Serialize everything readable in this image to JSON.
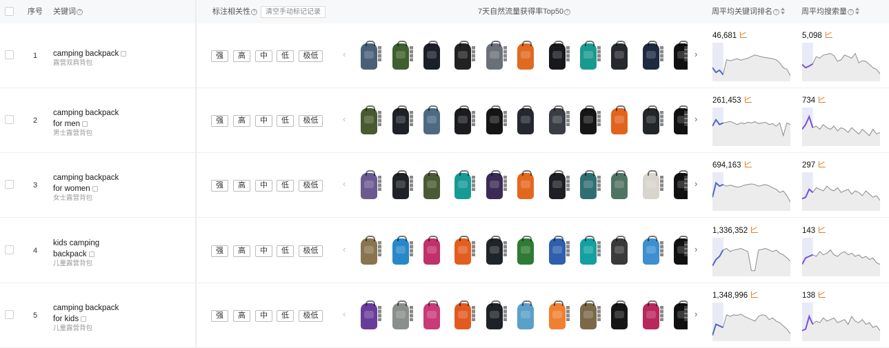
{
  "header": {
    "index_label": "序号",
    "keyword_label": "关键词",
    "relevance_label": "标注相关性",
    "clear_label": "清空手动标记记录",
    "top50_label": "7天自然流量获得率Top50",
    "rank_label": "周平均关键词排名",
    "search_label": "周平均搜索量"
  },
  "relevance_options": [
    "强",
    "高",
    "中",
    "低",
    "极低"
  ],
  "rows": [
    {
      "index": "1",
      "keyword_en": "camping backpack",
      "keyword_cn": "露营双肩背包",
      "rank": "46,681",
      "search": "5,098",
      "spark_rank": [
        0.7,
        0.85,
        0.78,
        0.92,
        0.45,
        0.48,
        0.45,
        0.42,
        0.46,
        0.43,
        0.4,
        0.35,
        0.3,
        0.33,
        0.36,
        0.38,
        0.4,
        0.42,
        0.45,
        0.55,
        0.7,
        0.75,
        0.95
      ],
      "spark_search": [
        0.6,
        0.7,
        0.65,
        0.58,
        0.35,
        0.4,
        0.3,
        0.28,
        0.25,
        0.32,
        0.5,
        0.45,
        0.3,
        0.35,
        0.4,
        0.25,
        0.55,
        0.48,
        0.5,
        0.6,
        0.7,
        0.75,
        0.9
      ],
      "bags": [
        "#4a6078",
        "#3f5f2e",
        "#1b1f2a",
        "#222222",
        "#6b7078",
        "#e06a20",
        "#16181c",
        "#1a9a8e",
        "#26292e",
        "#1d2a40",
        "#111111"
      ]
    },
    {
      "index": "2",
      "keyword_en": "camping backpack for men",
      "keyword_cn": "男士露营背包",
      "rank": "261,453",
      "search": "734",
      "spark_rank": [
        0.5,
        0.3,
        0.45,
        0.4,
        0.38,
        0.35,
        0.4,
        0.45,
        0.4,
        0.42,
        0.38,
        0.4,
        0.36,
        0.42,
        0.4,
        0.38,
        0.45,
        0.42,
        0.5,
        0.4,
        0.8,
        0.4,
        0.45
      ],
      "spark_search": [
        0.6,
        0.45,
        0.2,
        0.55,
        0.5,
        0.6,
        0.45,
        0.55,
        0.6,
        0.5,
        0.65,
        0.55,
        0.6,
        0.7,
        0.55,
        0.65,
        0.75,
        0.6,
        0.7,
        0.8,
        0.6,
        0.75,
        0.7
      ],
      "bags": [
        "#4a5a30",
        "#1e2226",
        "#4e6a82",
        "#1b1c1f",
        "#151515",
        "#25282e",
        "#3a3e44",
        "#161616",
        "#e3621e",
        "#232629",
        "#111111"
      ]
    },
    {
      "index": "3",
      "keyword_en": "camping backpack for women",
      "keyword_cn": "女士露营背包",
      "rank": "694,163",
      "search": "297",
      "spark_rank": [
        0.7,
        0.25,
        0.35,
        0.3,
        0.35,
        0.32,
        0.35,
        0.38,
        0.36,
        0.32,
        0.3,
        0.28,
        0.3,
        0.35,
        0.32,
        0.3,
        0.34,
        0.4,
        0.45,
        0.55,
        0.5,
        0.65,
        0.85
      ],
      "spark_search": [
        0.75,
        0.7,
        0.45,
        0.55,
        0.4,
        0.45,
        0.5,
        0.35,
        0.45,
        0.5,
        0.4,
        0.55,
        0.5,
        0.45,
        0.6,
        0.5,
        0.55,
        0.65,
        0.5,
        0.6,
        0.7,
        0.65,
        0.8
      ],
      "bags": [
        "#6b5a90",
        "#1f2227",
        "#4a5a34",
        "#159a94",
        "#3a2a55",
        "#e3681e",
        "#1e1f24",
        "#2f6f74",
        "#4f7463",
        "#d9d4cc",
        "#111111"
      ]
    },
    {
      "index": "4",
      "keyword_en": "kids camping backpack",
      "keyword_cn": "儿童露营背包",
      "rank": "1,336,352",
      "search": "143",
      "spark_rank": [
        0.8,
        0.6,
        0.5,
        0.3,
        0.25,
        0.35,
        0.3,
        0.28,
        0.25,
        0.3,
        0.35,
        0.95,
        0.95,
        0.3,
        0.28,
        0.25,
        0.3,
        0.35,
        0.3,
        0.4,
        0.45,
        0.55,
        0.65
      ],
      "spark_search": [
        0.75,
        0.55,
        0.5,
        0.45,
        0.5,
        0.35,
        0.45,
        0.4,
        0.3,
        0.45,
        0.5,
        0.4,
        0.35,
        0.45,
        0.4,
        0.5,
        0.45,
        0.55,
        0.5,
        0.6,
        0.55,
        0.7,
        0.75
      ],
      "bags": [
        "#8a7450",
        "#2688c8",
        "#c0306a",
        "#e35e1e",
        "#1f2428",
        "#2f7a34",
        "#2f5fae",
        "#13a0a0",
        "#3a3a3a",
        "#3d8fd0",
        "#111111"
      ]
    },
    {
      "index": "5",
      "keyword_en": "camping backpack for kids",
      "keyword_cn": "儿童露营背包",
      "rank": "1,348,996",
      "search": "138",
      "spark_rank": [
        0.95,
        0.6,
        0.65,
        0.7,
        0.3,
        0.35,
        0.3,
        0.32,
        0.28,
        0.35,
        0.4,
        0.45,
        0.5,
        0.35,
        0.3,
        0.32,
        0.45,
        0.4,
        0.5,
        0.55,
        0.65,
        0.75,
        0.9
      ],
      "spark_search": [
        0.8,
        0.75,
        0.35,
        0.6,
        0.5,
        0.55,
        0.4,
        0.5,
        0.45,
        0.4,
        0.55,
        0.5,
        0.45,
        0.6,
        0.35,
        0.5,
        0.55,
        0.45,
        0.6,
        0.55,
        0.7,
        0.65,
        0.8
      ],
      "bags": [
        "#6a3c9a",
        "#8a8f8c",
        "#c83a78",
        "#e25a20",
        "#1e2226",
        "#5aa0c8",
        "#f08030",
        "#7a6848",
        "#161616",
        "#b8285c",
        "#111111"
      ]
    }
  ]
}
